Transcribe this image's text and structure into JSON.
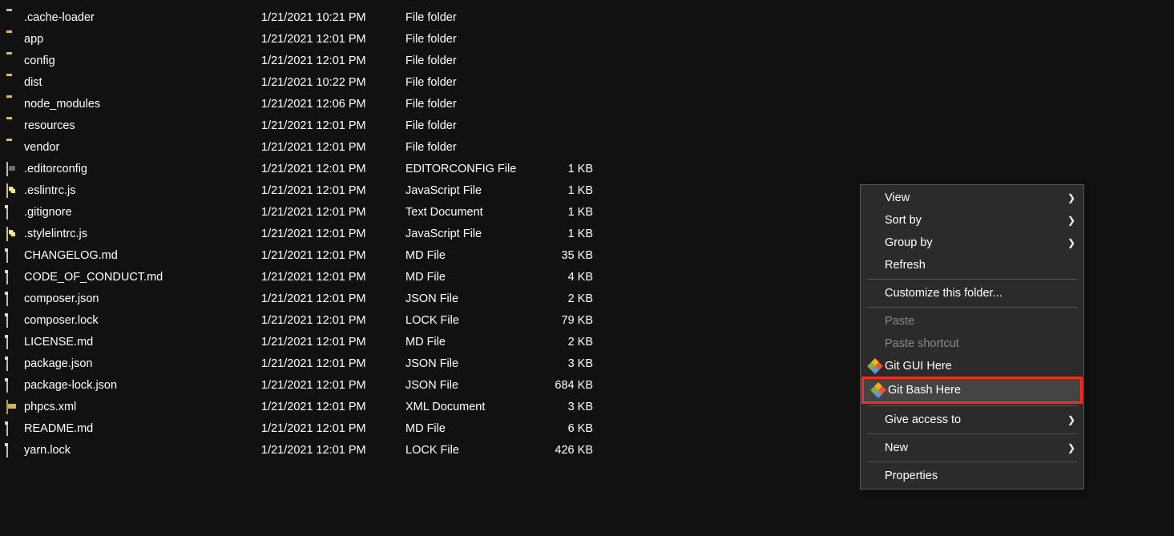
{
  "files": [
    {
      "name": ".cache-loader",
      "date": "1/21/2021 10:21 PM",
      "type": "File folder",
      "size": "",
      "icon": "folder"
    },
    {
      "name": "app",
      "date": "1/21/2021 12:01 PM",
      "type": "File folder",
      "size": "",
      "icon": "folder"
    },
    {
      "name": "config",
      "date": "1/21/2021 12:01 PM",
      "type": "File folder",
      "size": "",
      "icon": "folder"
    },
    {
      "name": "dist",
      "date": "1/21/2021 10:22 PM",
      "type": "File folder",
      "size": "",
      "icon": "folder"
    },
    {
      "name": "node_modules",
      "date": "1/21/2021 12:06 PM",
      "type": "File folder",
      "size": "",
      "icon": "folder"
    },
    {
      "name": "resources",
      "date": "1/21/2021 12:01 PM",
      "type": "File folder",
      "size": "",
      "icon": "folder"
    },
    {
      "name": "vendor",
      "date": "1/21/2021 12:01 PM",
      "type": "File folder",
      "size": "",
      "icon": "folder"
    },
    {
      "name": ".editorconfig",
      "date": "1/21/2021 12:01 PM",
      "type": "EDITORCONFIG File",
      "size": "1 KB",
      "icon": "cfg"
    },
    {
      "name": ".eslintrc.js",
      "date": "1/21/2021 12:01 PM",
      "type": "JavaScript File",
      "size": "1 KB",
      "icon": "js"
    },
    {
      "name": ".gitignore",
      "date": "1/21/2021 12:01 PM",
      "type": "Text Document",
      "size": "1 KB",
      "icon": "sheet"
    },
    {
      "name": ".stylelintrc.js",
      "date": "1/21/2021 12:01 PM",
      "type": "JavaScript File",
      "size": "1 KB",
      "icon": "js"
    },
    {
      "name": "CHANGELOG.md",
      "date": "1/21/2021 12:01 PM",
      "type": "MD File",
      "size": "35 KB",
      "icon": "sheet"
    },
    {
      "name": "CODE_OF_CONDUCT.md",
      "date": "1/21/2021 12:01 PM",
      "type": "MD File",
      "size": "4 KB",
      "icon": "sheet"
    },
    {
      "name": "composer.json",
      "date": "1/21/2021 12:01 PM",
      "type": "JSON File",
      "size": "2 KB",
      "icon": "sheet"
    },
    {
      "name": "composer.lock",
      "date": "1/21/2021 12:01 PM",
      "type": "LOCK File",
      "size": "79 KB",
      "icon": "sheet"
    },
    {
      "name": "LICENSE.md",
      "date": "1/21/2021 12:01 PM",
      "type": "MD File",
      "size": "2 KB",
      "icon": "sheet"
    },
    {
      "name": "package.json",
      "date": "1/21/2021 12:01 PM",
      "type": "JSON File",
      "size": "3 KB",
      "icon": "sheet"
    },
    {
      "name": "package-lock.json",
      "date": "1/21/2021 12:01 PM",
      "type": "JSON File",
      "size": "684 KB",
      "icon": "sheet"
    },
    {
      "name": "phpcs.xml",
      "date": "1/21/2021 12:01 PM",
      "type": "XML Document",
      "size": "3 KB",
      "icon": "xml"
    },
    {
      "name": "README.md",
      "date": "1/21/2021 12:01 PM",
      "type": "MD File",
      "size": "6 KB",
      "icon": "sheet"
    },
    {
      "name": "yarn.lock",
      "date": "1/21/2021 12:01 PM",
      "type": "LOCK File",
      "size": "426 KB",
      "icon": "sheet"
    }
  ],
  "menu": {
    "view": "View",
    "sort_by": "Sort by",
    "group_by": "Group by",
    "refresh": "Refresh",
    "customize": "Customize this folder...",
    "paste": "Paste",
    "paste_shortcut": "Paste shortcut",
    "git_gui": "Git GUI Here",
    "git_bash": "Git Bash Here",
    "give_access": "Give access to",
    "new": "New",
    "properties": "Properties"
  }
}
